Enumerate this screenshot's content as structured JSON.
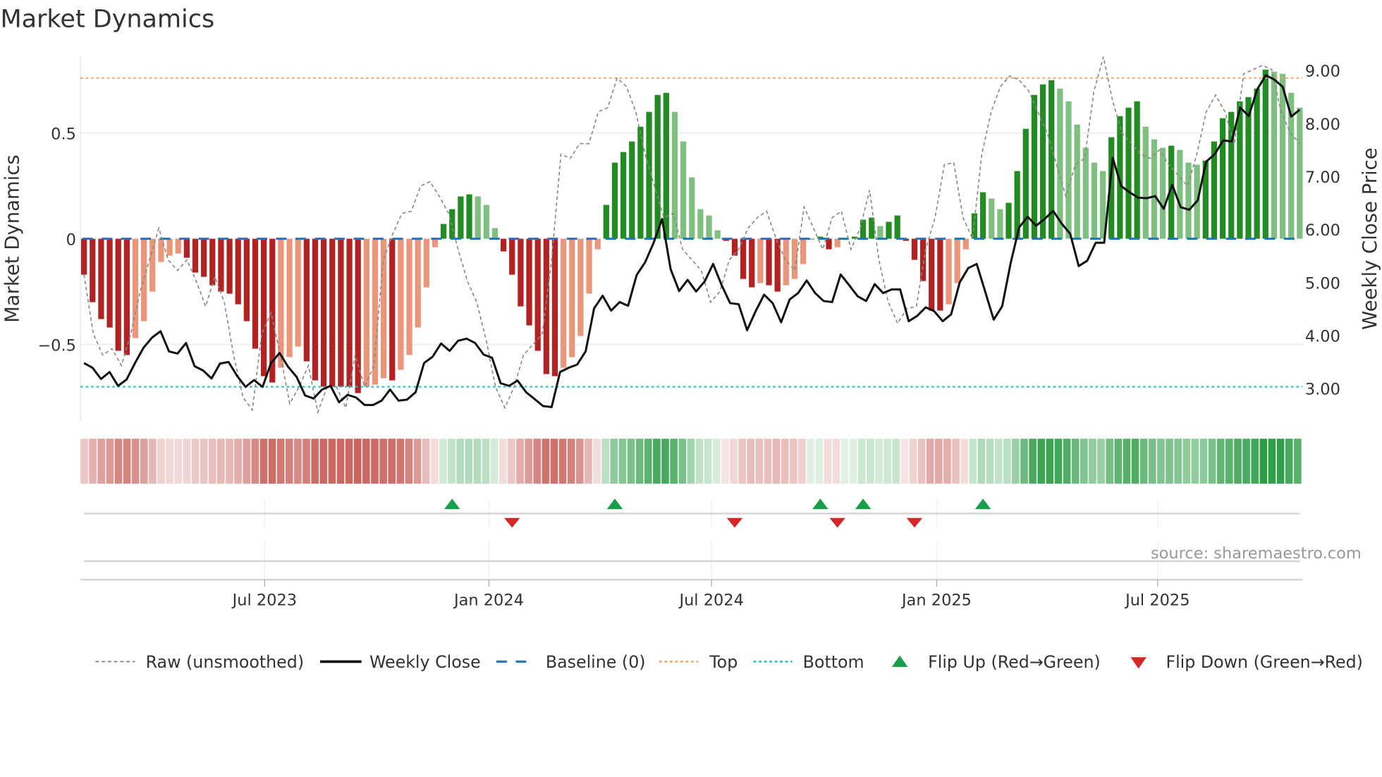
{
  "chart_data": {
    "type": "bar",
    "title": "Market Dynamics",
    "ylabel": "Market Dynamics",
    "y2label": "Weekly Close Price",
    "ylim": [
      -0.87,
      0.87
    ],
    "y2lim": [
      2.55,
      9.3
    ],
    "yticks": [
      {
        "v": 0.5,
        "label": "0.5"
      },
      {
        "v": 0,
        "label": "0"
      },
      {
        "v": -0.5,
        "label": "−0.5"
      }
    ],
    "y2ticks": [
      {
        "v": 9,
        "label": "9.00"
      },
      {
        "v": 8,
        "label": "8.00"
      },
      {
        "v": 7,
        "label": "7.00"
      },
      {
        "v": 6,
        "label": "6.00"
      },
      {
        "v": 5,
        "label": "5.00"
      },
      {
        "v": 4,
        "label": "4.00"
      },
      {
        "v": 3,
        "label": "3.00"
      }
    ],
    "xticks": [
      {
        "week": 21.1,
        "label": "Jul 2023"
      },
      {
        "week": 47.3,
        "label": "Jan 2024"
      },
      {
        "week": 73.3,
        "label": "Jul 2024"
      },
      {
        "week": 99.6,
        "label": "Jan 2025"
      },
      {
        "week": 125.4,
        "label": "Jul 2025"
      }
    ],
    "top_level": 0.76,
    "bottom_level": -0.7,
    "baseline": 0,
    "colors": {
      "dark_red": "#b22222",
      "light_red": "#e9967a",
      "dark_green": "#228b22",
      "light_green": "#7fbf7f",
      "close": "#111111",
      "raw": "#888888",
      "baseline": "#1f77b4",
      "top": "#f4a460",
      "bottom": "#17becf",
      "flip_up": "#1a9e4a",
      "flip_down": "#d62728"
    },
    "smoothed": [
      -0.17,
      -0.3,
      -0.38,
      -0.42,
      -0.53,
      -0.55,
      -0.47,
      -0.39,
      -0.25,
      -0.11,
      -0.08,
      -0.07,
      -0.09,
      -0.16,
      -0.18,
      -0.22,
      -0.25,
      -0.26,
      -0.31,
      -0.39,
      -0.52,
      -0.65,
      -0.68,
      -0.61,
      -0.56,
      -0.51,
      -0.58,
      -0.67,
      -0.7,
      -0.7,
      -0.7,
      -0.7,
      -0.73,
      -0.7,
      -0.69,
      -0.66,
      -0.67,
      -0.62,
      -0.55,
      -0.42,
      -0.23,
      -0.04,
      0.07,
      0.14,
      0.2,
      0.21,
      0.2,
      0.16,
      0.05,
      -0.06,
      -0.17,
      -0.32,
      -0.41,
      -0.53,
      -0.64,
      -0.65,
      -0.61,
      -0.56,
      -0.46,
      -0.26,
      -0.05,
      0.16,
      0.36,
      0.41,
      0.46,
      0.53,
      0.6,
      0.68,
      0.69,
      0.6,
      0.46,
      0.29,
      0.14,
      0.11,
      0.04,
      -0.01,
      -0.08,
      -0.19,
      -0.23,
      -0.21,
      -0.22,
      -0.25,
      -0.22,
      -0.19,
      -0.12,
      0.0,
      0.01,
      -0.05,
      -0.04,
      0.0,
      0.01,
      0.09,
      0.1,
      0.06,
      0.08,
      0.11,
      -0.01,
      -0.1,
      -0.2,
      -0.34,
      -0.34,
      -0.31,
      -0.21,
      -0.05,
      0.12,
      0.22,
      0.19,
      0.14,
      0.17,
      0.32,
      0.52,
      0.68,
      0.73,
      0.75,
      0.71,
      0.65,
      0.54,
      0.43,
      0.36,
      0.32,
      0.48,
      0.58,
      0.62,
      0.65,
      0.53,
      0.47,
      0.43,
      0.44,
      0.42,
      0.36,
      0.35,
      0.37,
      0.46,
      0.57,
      0.6,
      0.65,
      0.67,
      0.71,
      0.8,
      0.79,
      0.78,
      0.69,
      0.62
    ],
    "raw": [
      -0.17,
      -0.45,
      -0.55,
      -0.52,
      -0.6,
      -0.45,
      -0.25,
      -0.1,
      0.05,
      -0.1,
      -0.15,
      -0.1,
      -0.2,
      -0.32,
      -0.18,
      -0.3,
      -0.55,
      -0.75,
      -0.81,
      -0.45,
      -0.35,
      -0.55,
      -0.78,
      -0.7,
      -0.6,
      -0.82,
      -0.7,
      -0.7,
      -0.8,
      -0.55,
      -0.7,
      -0.6,
      -0.1,
      0.02,
      0.12,
      0.13,
      0.25,
      0.27,
      0.2,
      0.12,
      -0.05,
      -0.2,
      -0.3,
      -0.48,
      -0.7,
      -0.8,
      -0.7,
      -0.55,
      -0.5,
      -0.45,
      -0.1,
      0.4,
      0.38,
      0.45,
      0.45,
      0.6,
      0.62,
      0.76,
      0.72,
      0.6,
      0.4,
      0.25,
      0.1,
      0.12,
      -0.05,
      -0.1,
      -0.15,
      -0.3,
      -0.25,
      -0.1,
      -0.05,
      0.05,
      0.1,
      0.13,
      0.0,
      -0.1,
      -0.15,
      0.15,
      0.05,
      -0.05,
      0.1,
      0.13,
      -0.05,
      0.05,
      0.23,
      -0.1,
      -0.3,
      -0.4,
      -0.33,
      -0.32,
      -0.05,
      0.1,
      0.35,
      0.36,
      0.1,
      0.0,
      0.4,
      0.6,
      0.72,
      0.77,
      0.75,
      0.7,
      0.6,
      0.5,
      0.35,
      0.2,
      0.35,
      0.38,
      0.7,
      0.86,
      0.65,
      0.5,
      0.45,
      0.4,
      0.38,
      0.42,
      0.35,
      0.3,
      0.25,
      0.4,
      0.6,
      0.68,
      0.6,
      0.45,
      0.78,
      0.8,
      0.82,
      0.8,
      0.6,
      0.5,
      0.45
    ],
    "weekly_close": [
      3.48,
      3.39,
      3.18,
      3.31,
      3.05,
      3.17,
      3.48,
      3.77,
      3.96,
      4.08,
      3.7,
      3.66,
      3.86,
      3.42,
      3.34,
      3.19,
      3.47,
      3.5,
      3.24,
      3.03,
      3.16,
      3.03,
      3.48,
      3.67,
      3.41,
      3.22,
      2.87,
      2.81,
      2.98,
      3.05,
      2.74,
      2.88,
      2.83,
      2.69,
      2.69,
      2.77,
      2.98,
      2.77,
      2.79,
      2.93,
      3.48,
      3.6,
      3.85,
      3.71,
      3.9,
      3.94,
      3.86,
      3.64,
      3.58,
      3.1,
      3.05,
      3.15,
      2.93,
      2.8,
      2.67,
      2.65,
      3.31,
      3.39,
      3.45,
      3.7,
      4.51,
      4.75,
      4.47,
      4.63,
      4.56,
      5.14,
      5.38,
      5.75,
      6.2,
      5.25,
      4.84,
      5.05,
      4.83,
      5.02,
      5.35,
      4.95,
      4.61,
      4.59,
      4.1,
      4.46,
      4.77,
      4.61,
      4.25,
      4.68,
      4.8,
      5.04,
      4.8,
      4.65,
      4.63,
      5.15,
      4.95,
      4.74,
      4.65,
      4.97,
      4.8,
      4.87,
      4.87,
      4.27,
      4.37,
      4.53,
      4.46,
      4.27,
      4.4,
      5.0,
      5.27,
      5.35,
      4.83,
      4.3,
      4.55,
      5.37,
      6.04,
      6.24,
      6.07,
      6.2,
      6.35,
      6.11,
      5.92,
      5.31,
      5.41,
      5.75,
      5.75,
      7.35,
      6.82,
      6.7,
      6.6,
      6.59,
      6.63,
      6.39,
      6.84,
      6.42,
      6.37,
      6.55,
      7.28,
      7.42,
      7.68,
      7.66,
      8.3,
      8.14,
      8.64,
      8.91,
      8.83,
      8.69,
      8.13,
      8.26
    ],
    "flip_up_weeks": [
      43,
      62,
      86,
      91,
      105
    ],
    "flip_down_weeks": [
      50,
      76,
      88,
      97
    ],
    "legend": {
      "placement": "bottom",
      "items": [
        "Raw (unsmoothed)",
        "Weekly Close",
        "Baseline (0)",
        "Top",
        "Bottom",
        "Flip Up (Red→Green)",
        "Flip Down (Green→Red)"
      ]
    },
    "source": "source: sharemaestro.com"
  }
}
